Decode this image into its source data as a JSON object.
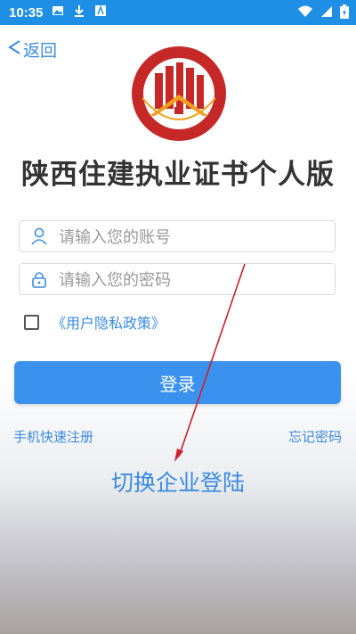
{
  "statusbar": {
    "time": "10:35"
  },
  "nav": {
    "back_label": "返回"
  },
  "logo": {
    "text": "陕西省住建综合服务中心"
  },
  "title": "陕西住建执业证书个人版",
  "account": {
    "placeholder": "请输入您的账号"
  },
  "password": {
    "placeholder": "请输入您的密码"
  },
  "privacy": {
    "label": "《用户隐私政策》",
    "checked": false
  },
  "login": {
    "label": "登录"
  },
  "links": {
    "register": "手机快速注册",
    "forgot": "忘记密码"
  },
  "switch_label": "切换企业登陆",
  "colors": {
    "accent": "#3b92ee",
    "status_bar": "#1f8fe6",
    "annotation_arrow": "#cc1f2b"
  }
}
